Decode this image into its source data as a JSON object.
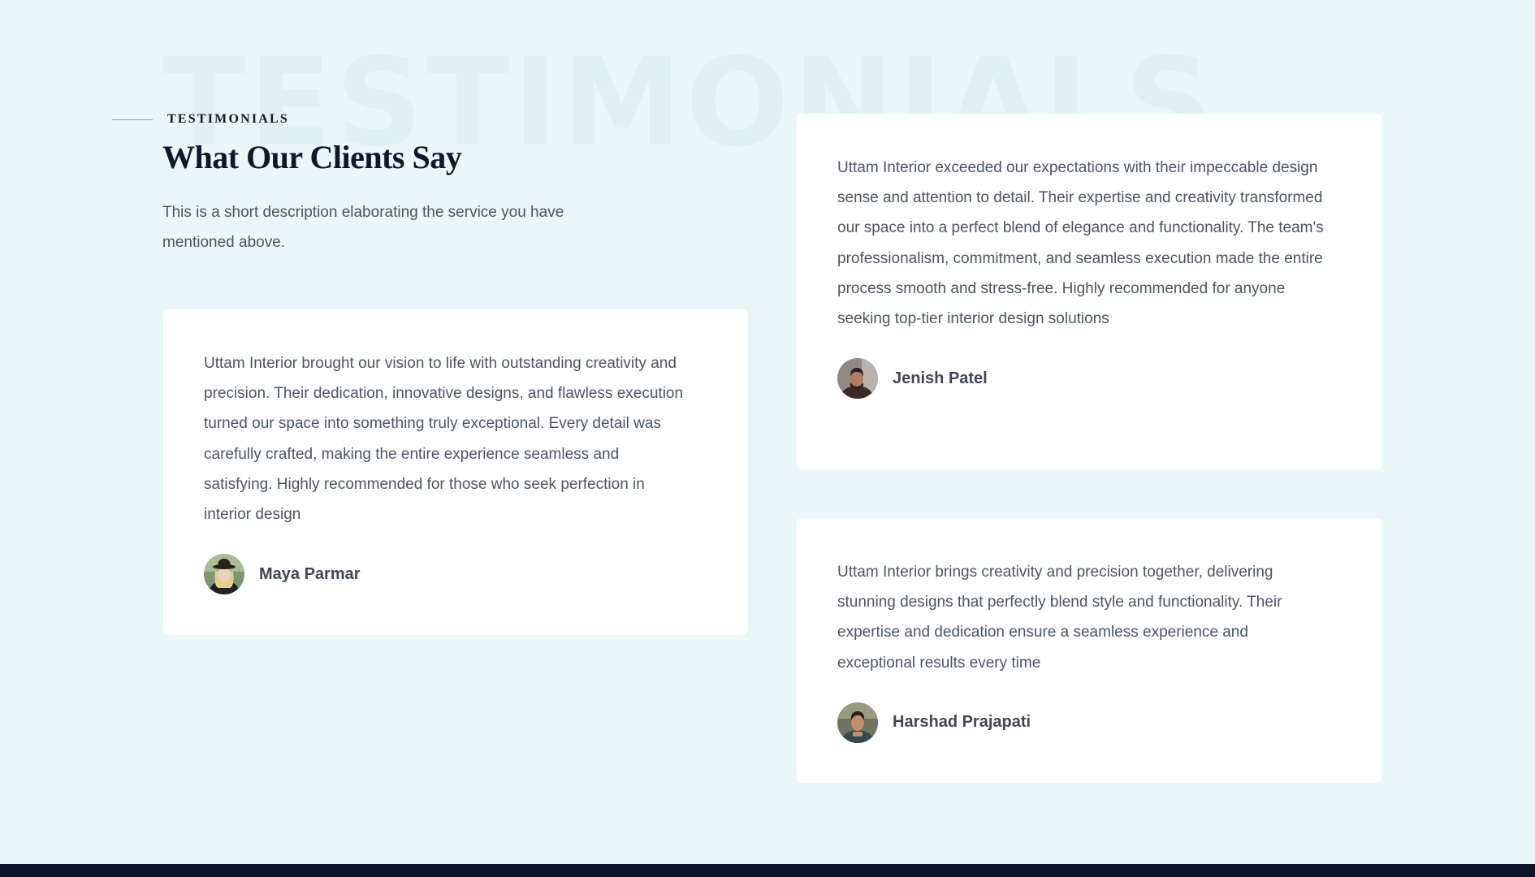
{
  "section": {
    "background_word": "TESTIMONIALS",
    "eyebrow": "TESTIMONIALS",
    "title": "What Our Clients Say",
    "description": "This is a short description elaborating the service you have mentioned above."
  },
  "testimonials": [
    {
      "quote": "Uttam Interior brought our vision to life with outstanding creativity and precision. Their dedication, innovative designs, and flawless execution turned our space into something truly exceptional. Every detail was carefully crafted, making the entire experience seamless and satisfying. Highly recommended for those who seek perfection in interior design",
      "author": "Maya Parmar"
    },
    {
      "quote": "Uttam Interior exceeded our expectations with their impeccable design sense and attention to detail. Their expertise and creativity transformed our space into a perfect blend of elegance and functionality. The team's professionalism, commitment, and seamless execution made the entire process smooth and stress-free. Highly recommended for anyone seeking top-tier interior design solutions",
      "author": "Jenish Patel"
    },
    {
      "quote": "Uttam Interior brings creativity and precision together, delivering stunning designs that perfectly blend style and functionality. Their expertise and dedication ensure a seamless experience and exceptional results every time",
      "author": "Harshad Prajapati"
    }
  ],
  "colors": {
    "background": "#e9f7f8",
    "card": "#ffffff",
    "heading": "#0f172a",
    "body_text": "#4b5563",
    "accent_line": "#67b7c4",
    "footer": "#0f172a"
  }
}
